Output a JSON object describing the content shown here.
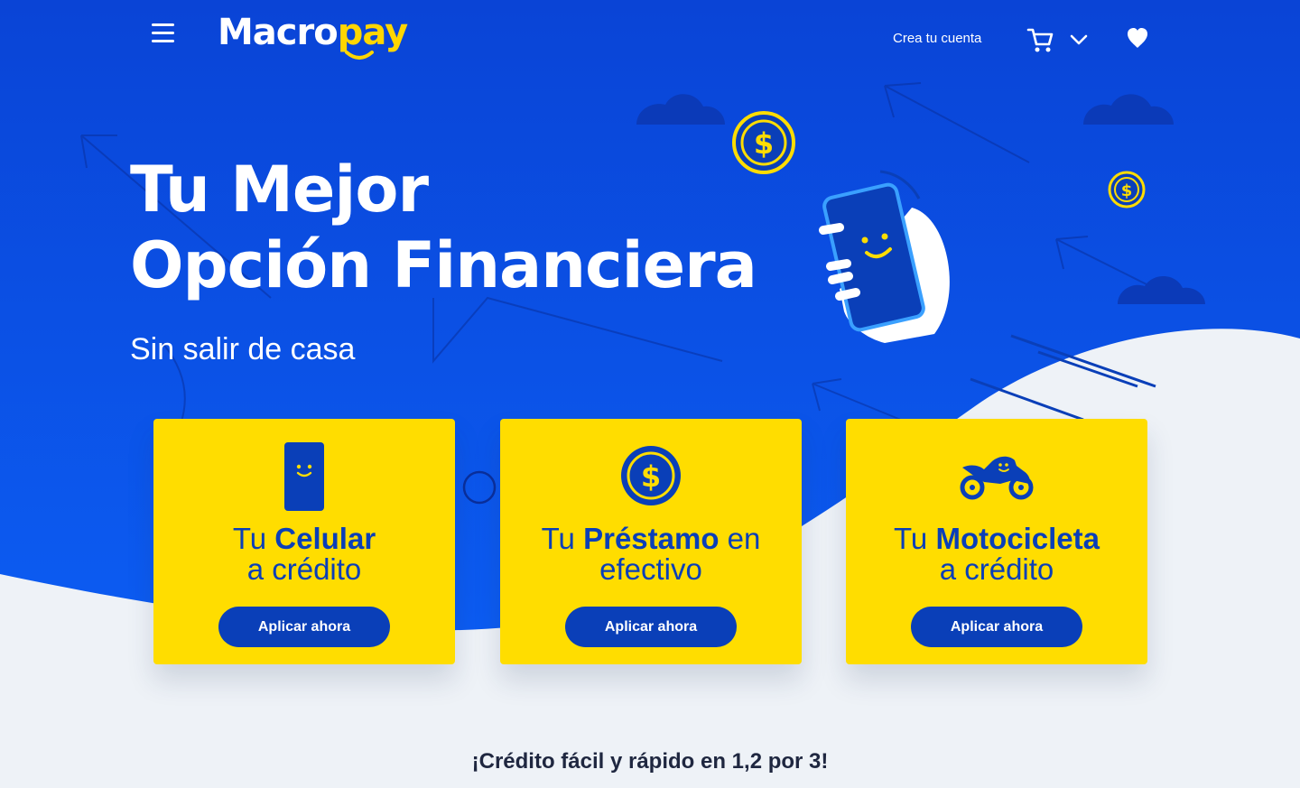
{
  "header": {
    "logo": {
      "part1": "Macro",
      "part2": "pay"
    },
    "create_account": "Crea tu cuenta",
    "icons": [
      "menu-icon",
      "cart-icon",
      "chevron-down-icon",
      "heart-icon"
    ]
  },
  "hero": {
    "title_line1": "Tu Mejor",
    "title_line2": "Opción Financiera",
    "subtitle": "Sin salir de casa"
  },
  "cards": [
    {
      "prefix": "Tu ",
      "highlight": "Celular",
      "suffix": "",
      "line2": "a crédito",
      "button": "Aplicar ahora",
      "icon": "phone-icon"
    },
    {
      "prefix": "Tu ",
      "highlight": "Préstamo",
      "suffix": " en",
      "line2": "efectivo",
      "button": "Aplicar ahora",
      "icon": "coin-icon"
    },
    {
      "prefix": "Tu ",
      "highlight": "Motocicleta",
      "suffix": "",
      "line2": "a crédito",
      "button": "Aplicar ahora",
      "icon": "motorcycle-icon"
    }
  ],
  "tagline": "¡Crédito fácil y rápido en 1,2 por 3!",
  "colors": {
    "brand_blue": "#0a3fb8",
    "hero_blue": "#0d4fe0",
    "brand_yellow": "#ffdd00",
    "light_bg": "#eef2f7"
  }
}
